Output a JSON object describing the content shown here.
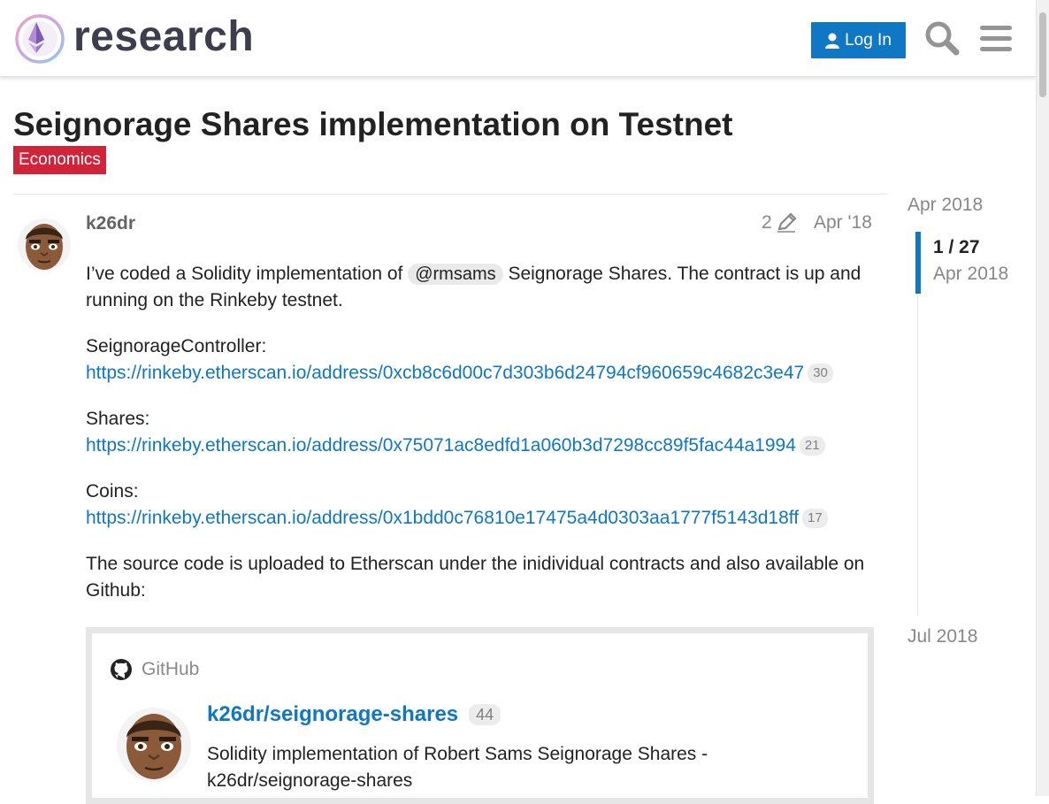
{
  "header": {
    "logo_text": "research",
    "login_label": "Log In"
  },
  "topic": {
    "title": "Seignorage Shares implementation on Testnet",
    "category": "Economics"
  },
  "post": {
    "username": "k26dr",
    "edit_count": "2",
    "date": "Apr '18",
    "intro_before": "I’ve coded a Solidity implementation of ",
    "mention": "@rmsams",
    "intro_after": " Seignorage Shares. The contract is up and running on the Rinkeby testnet.",
    "contracts": [
      {
        "label": "SeignorageController:",
        "url": "https://rinkeby.etherscan.io/address/0xcb8c6d00c7d303b6d24794cf960659c4682c3e47",
        "clicks": "30"
      },
      {
        "label": "Shares:",
        "url": "https://rinkeby.etherscan.io/address/0x75071ac8edfd1a060b3d7298cc89f5fac44a1994",
        "clicks": "21"
      },
      {
        "label": "Coins:",
        "url": "https://rinkeby.etherscan.io/address/0x1bdd0c76810e17475a4d0303aa1777f5143d18ff",
        "clicks": "17"
      }
    ],
    "source_text": "The source code is uploaded to Etherscan under the inidividual contracts and also available on Github:"
  },
  "onebox": {
    "source": "GitHub",
    "title": "k26dr/seignorage-shares",
    "clicks": "44",
    "description": "Solidity implementation of Robert Sams Seignorage Shares - k26dr/seignorage-shares"
  },
  "timeline": {
    "top_date": "Apr 2018",
    "position": "1 / 27",
    "current_date": "Apr 2018",
    "bottom_date": "Jul 2018"
  },
  "colors": {
    "accent": "#0f77c3",
    "category": "#d0243b"
  }
}
